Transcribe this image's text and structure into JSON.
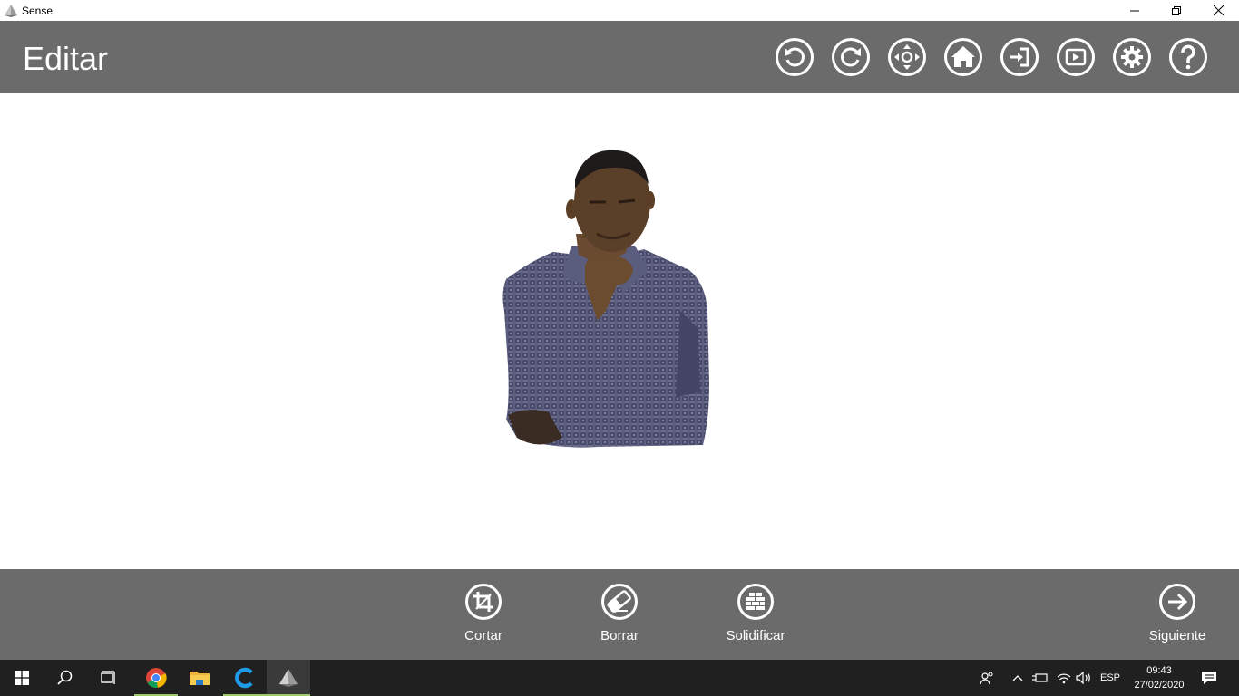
{
  "window": {
    "title": "Sense",
    "minimize_icon": "minimize-icon",
    "restore_icon": "restore-icon",
    "close_icon": "close-icon"
  },
  "header": {
    "title": "Editar",
    "tools": [
      {
        "name": "undo",
        "icon": "undo-icon"
      },
      {
        "name": "redo",
        "icon": "redo-icon"
      },
      {
        "name": "move",
        "icon": "move-icon"
      },
      {
        "name": "home",
        "icon": "home-icon"
      },
      {
        "name": "import",
        "icon": "import-icon"
      },
      {
        "name": "play",
        "icon": "play-icon"
      },
      {
        "name": "settings",
        "icon": "gear-icon"
      },
      {
        "name": "help",
        "icon": "help-icon"
      }
    ]
  },
  "actions": {
    "crop": "Cortar",
    "erase": "Borrar",
    "solidify": "Solidificar",
    "next": "Siguiente"
  },
  "taskbar": {
    "language": "ESP",
    "time": "09:43",
    "date": "27/02/2020"
  },
  "colors": {
    "bar_gray": "#6b6b6b",
    "taskbar": "#202020",
    "white": "#ffffff"
  }
}
